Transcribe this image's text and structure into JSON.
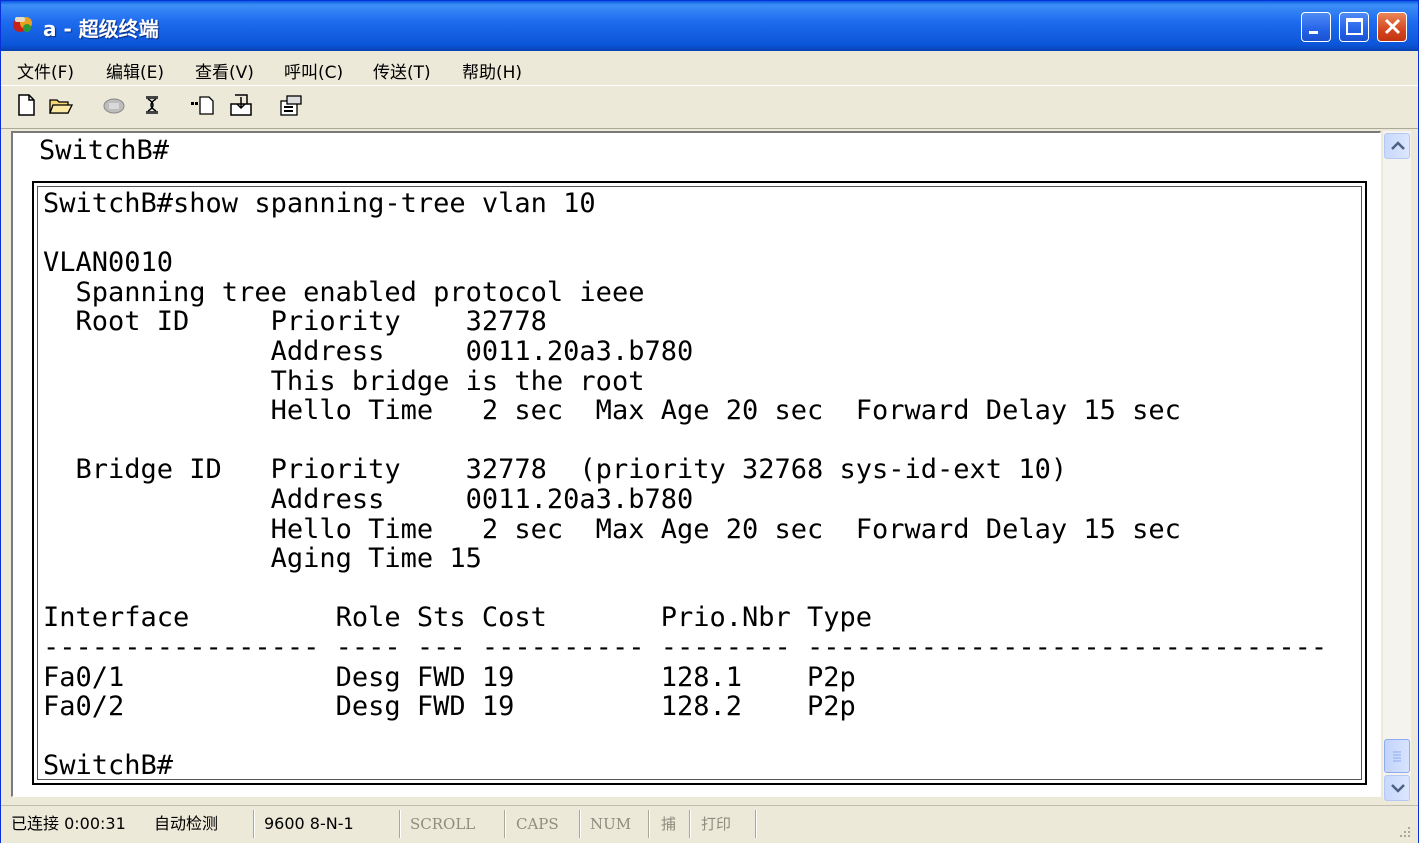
{
  "window": {
    "title": "a - 超级终端",
    "accent": "#0a5be0"
  },
  "menu": [
    {
      "label": "文件(F)"
    },
    {
      "label": "编辑(E)"
    },
    {
      "label": "查看(V)"
    },
    {
      "label": "呼叫(C)"
    },
    {
      "label": "传送(T)"
    },
    {
      "label": "帮助(H)"
    }
  ],
  "toolbar": {
    "icons": [
      "new-document-icon",
      "open-folder-icon",
      "call-icon",
      "disconnect-icon",
      "send-file-icon",
      "receive-file-icon",
      "properties-icon"
    ]
  },
  "terminal": {
    "top_line": "SwitchB#",
    "lines": [
      "SwitchB#show spanning-tree vlan 10",
      "",
      "VLAN0010",
      "  Spanning tree enabled protocol ieee",
      "  Root ID     Priority    32778",
      "              Address     0011.20a3.b780",
      "              This bridge is the root",
      "              Hello Time   2 sec  Max Age 20 sec  Forward Delay 15 sec",
      "",
      "  Bridge ID   Priority    32778  (priority 32768 sys-id-ext 10)",
      "              Address     0011.20a3.b780",
      "              Hello Time   2 sec  Max Age 20 sec  Forward Delay 15 sec",
      "              Aging Time 15",
      "",
      "Interface         Role Sts Cost       Prio.Nbr Type",
      "----------------- ---- --- ---------- -------- --------------------------------",
      "Fa0/1             Desg FWD 19         128.1    P2p",
      "Fa0/2             Desg FWD 19         128.2    P2p",
      "",
      "SwitchB#"
    ]
  },
  "status": {
    "connection": "已连接 0:00:31",
    "detect": "自动检测",
    "port": "9600 8-N-1",
    "scroll": "SCROLL",
    "caps": "CAPS",
    "num": "NUM",
    "capture": "捕",
    "print": "打印"
  }
}
